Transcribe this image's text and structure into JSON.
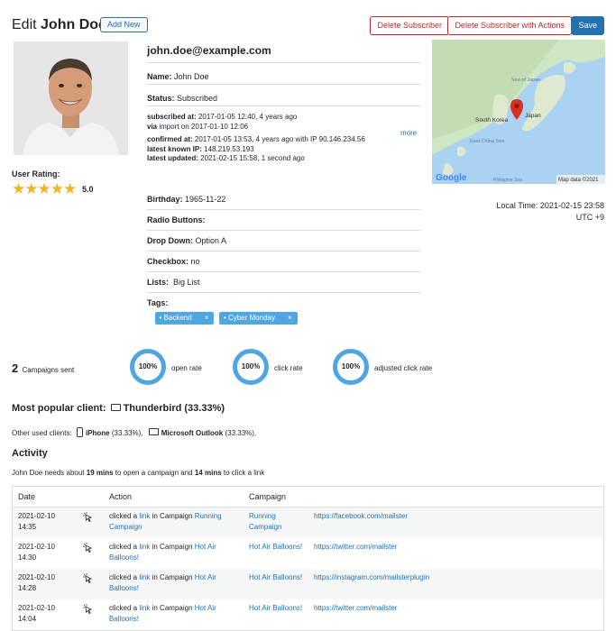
{
  "header": {
    "title_prefix": "Edit",
    "title_name": "John Doe",
    "add_new": "Add New",
    "delete_subscriber": "Delete Subscriber",
    "delete_with_actions": "Delete Subscriber with Actions",
    "save": "Save"
  },
  "profile": {
    "rating_label": "User Rating:",
    "rating_value": "5.0",
    "rating": 5
  },
  "info": {
    "email": "john.doe@example.com",
    "name_label": "Name:",
    "name_value": "John Doe",
    "status_label": "Status:",
    "status_value": "Subscribed",
    "subscribed_label": "subscribed at:",
    "subscribed_value": "2017-01-05 12:40, 4 years ago",
    "via_label": "via",
    "via_value": "import on 2017-01-10 12:06",
    "confirmed_label": "confirmed at:",
    "confirmed_value": "2017-01-05 13:53, 4 years ago with IP 90.146.234.56",
    "ip_label": "latest known IP:",
    "ip_value": "148.219.53.193",
    "updated_label": "latest updated:",
    "updated_value": "2021-02-15 15:58, 1 second ago",
    "more": "more"
  },
  "fields": {
    "birthday_label": "Birthday:",
    "birthday_value": "1965-11-22",
    "radio_label": "Radio Buttons:",
    "dropdown_label": "Drop Down:",
    "dropdown_value": "Option A",
    "checkbox_label": "Checkbox:",
    "checkbox_value": "no",
    "lists_label": "Lists:",
    "lists_value": "Big List",
    "tags_label": "Tags:",
    "tags": [
      "Backend",
      "Cyber Monday"
    ],
    "tag_remove": "×"
  },
  "map": {
    "label_korea": "South Korea",
    "label_japan": "Japan",
    "label_sea1": "Sea of Japan",
    "label_ecs": "East China Sea",
    "label_ph": "Philippine Sea",
    "google": "Google",
    "attribution": "Map data ©2021"
  },
  "localtime": {
    "line1": "Local Time: 2021-02-15 23:58",
    "line2": "UTC +9"
  },
  "stats": {
    "campaigns_count": "2",
    "campaigns_label": "Campaigns sent",
    "open_rate": "100%",
    "open_rate_label": "open rate",
    "click_rate": "100%",
    "click_rate_label": "click rate",
    "adj_click_rate": "100%",
    "adj_click_rate_label": "adjusted click rate"
  },
  "clients": {
    "popular_label": "Most popular client:",
    "popular_value": "Thunderbird (33.33%)",
    "other_label": "Other used clients:",
    "other1_name": "iPhone",
    "other1_pct": "(33.33%),",
    "other2_name": "Microsoft Outlook",
    "other2_pct": "(33.33%),"
  },
  "activity": {
    "title": "Activity",
    "summary_pre": "John Doe needs about",
    "open_time": "19 mins",
    "summary_mid": "to open a campaign and",
    "click_time": "14 mins",
    "summary_post": "to click a link",
    "headers": {
      "date": "Date",
      "action": "Action",
      "campaign": "Campaign"
    },
    "rows": [
      {
        "date": "2021-02-10 14:35",
        "pre": "clicked a",
        "link": "link",
        "mid": "in Campaign",
        "camp": "Running Campaign",
        "campaign": "Running Campaign",
        "url": "https://facebook.com/mailster"
      },
      {
        "date": "2021-02-10 14:30",
        "pre": "clicked a",
        "link": "link",
        "mid": "in Campaign",
        "camp": "Hot Air Balloons!",
        "campaign": "Hot Air Balloons!",
        "url": "https://twitter.com/mailster"
      },
      {
        "date": "2021-02-10 14:28",
        "pre": "clicked a",
        "link": "link",
        "mid": "in Campaign",
        "camp": "Hot Air Balloons!",
        "campaign": "Hot Air Balloons!",
        "url": "https://instagram.com/mailsterplugin"
      },
      {
        "date": "2021-02-10 14:04",
        "pre": "clicked a",
        "link": "link",
        "mid": "in Campaign",
        "camp": "Hot Air Balloons!",
        "campaign": "Hot Air Balloons!",
        "url": "https://twitter.com/mailster"
      }
    ]
  },
  "colors": {
    "accent": "#2271b1",
    "danger": "#b32d2e",
    "star": "#f0b429",
    "ring": "#4fa6e1"
  }
}
